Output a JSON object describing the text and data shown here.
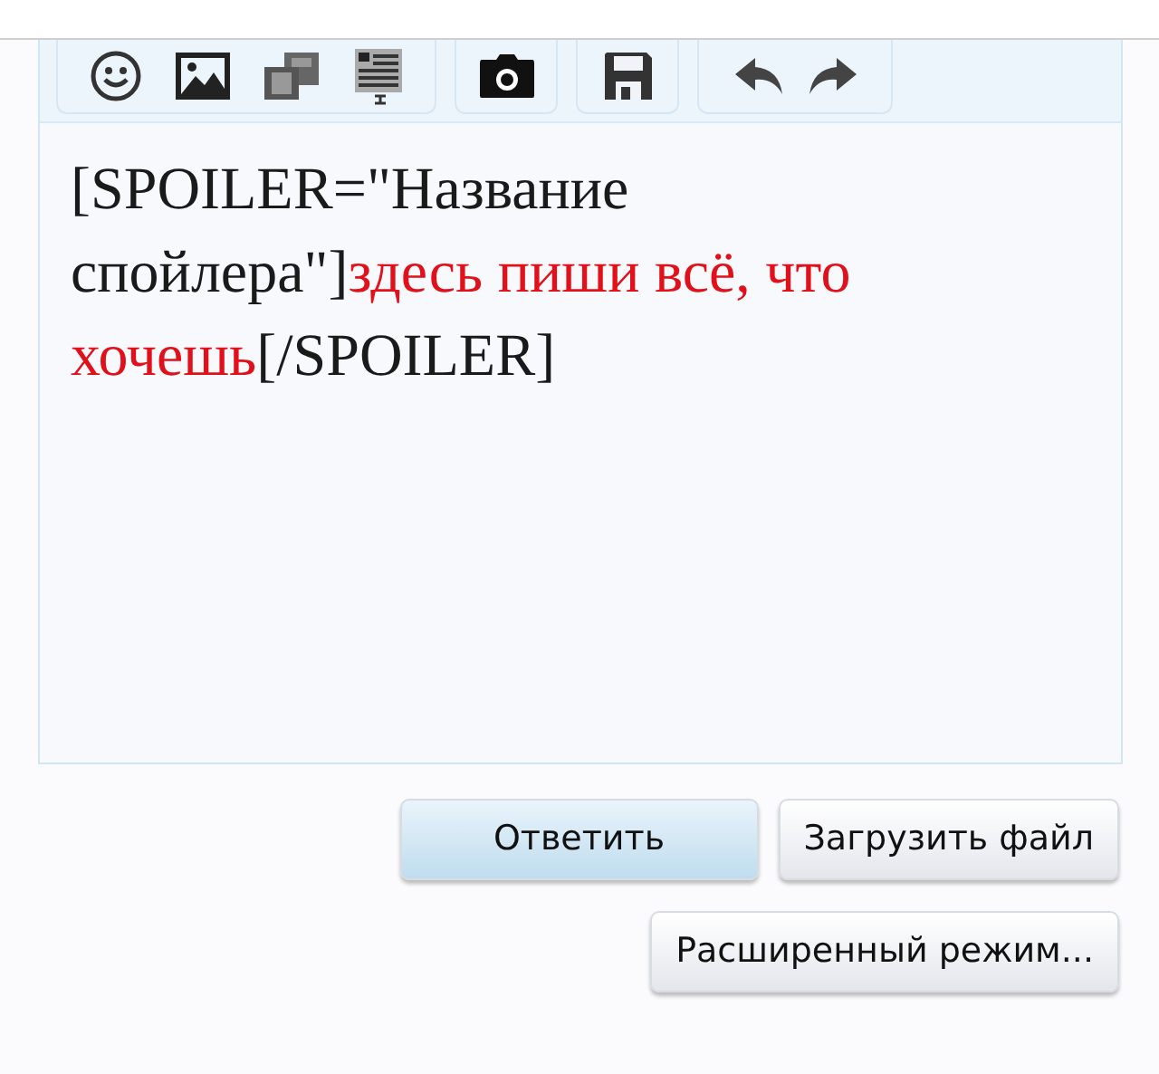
{
  "editor": {
    "segments": [
      {
        "text": "[SPOILER=\"Название спойлера\"]",
        "color": "#1a1a1a"
      },
      {
        "text": "здесь пиши всё, что хочешь",
        "color": "#e0111b"
      },
      {
        "text": "[/SPOILER]",
        "color": "#1a1a1a"
      }
    ]
  },
  "buttons": [
    {
      "label": "Ответить",
      "kind": "primary"
    },
    {
      "label": "Загрузить файл",
      "kind": "secondary"
    },
    {
      "label": "Расширенный режим...",
      "kind": "secondary"
    }
  ]
}
